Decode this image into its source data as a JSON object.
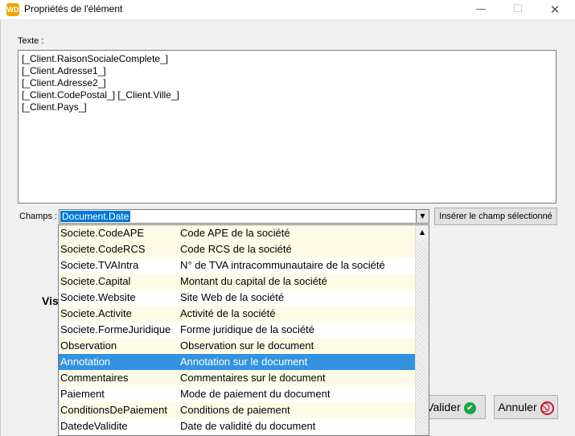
{
  "window": {
    "title": "Propriétés de l'élément",
    "app_icon_label": "WD",
    "minimize_icon": "—",
    "maximize_icon": "☐",
    "close_icon": "✕"
  },
  "form": {
    "texte_label": "Texte :",
    "texte_lines": [
      "[_Client.RaisonSocialeComplete_]",
      "[_Client.Adresse1_]",
      "[_Client.Adresse2_]",
      "[_Client.CodePostal_] [_Client.Ville_]",
      "[_Client.Pays_]"
    ],
    "champs_label": "Champs :",
    "champs_selected": "Document.Date",
    "insert_button": "Insérer le champ sélectionné",
    "visibility_label_partial": "Visi",
    "valider_button": "Valider",
    "annuler_button": "Annuler"
  },
  "dropdown": {
    "items": [
      {
        "field": "Societe.CodeAPE",
        "desc": "Code APE de la société"
      },
      {
        "field": "Societe.CodeRCS",
        "desc": "Code RCS de la société"
      },
      {
        "field": "Societe.TVAIntra",
        "desc": "N° de TVA intracommunautaire de la société"
      },
      {
        "field": "Societe.Capital",
        "desc": "Montant du capital de la société"
      },
      {
        "field": "Societe.Website",
        "desc": "Site Web de la société"
      },
      {
        "field": "Societe.Activite",
        "desc": "Activité de la société"
      },
      {
        "field": "Societe.FormeJuridique",
        "desc": "Forme juridique de la société"
      },
      {
        "field": "Observation",
        "desc": "Observation sur le document"
      },
      {
        "field": "Annotation",
        "desc": "Annotation sur le document"
      },
      {
        "field": "Commentaires",
        "desc": "Commentaires sur le document"
      },
      {
        "field": "Paiement",
        "desc": "Mode de paiement du document"
      },
      {
        "field": "ConditionsDePaiement",
        "desc": "Conditions de paiement"
      },
      {
        "field": "DatedeValidite",
        "desc": "Date de validité du document"
      }
    ],
    "selected_index": 8
  },
  "colors": {
    "selection": "#3393df",
    "combo_selection": "#0078d7",
    "alt_row": "#fdfbe6"
  }
}
